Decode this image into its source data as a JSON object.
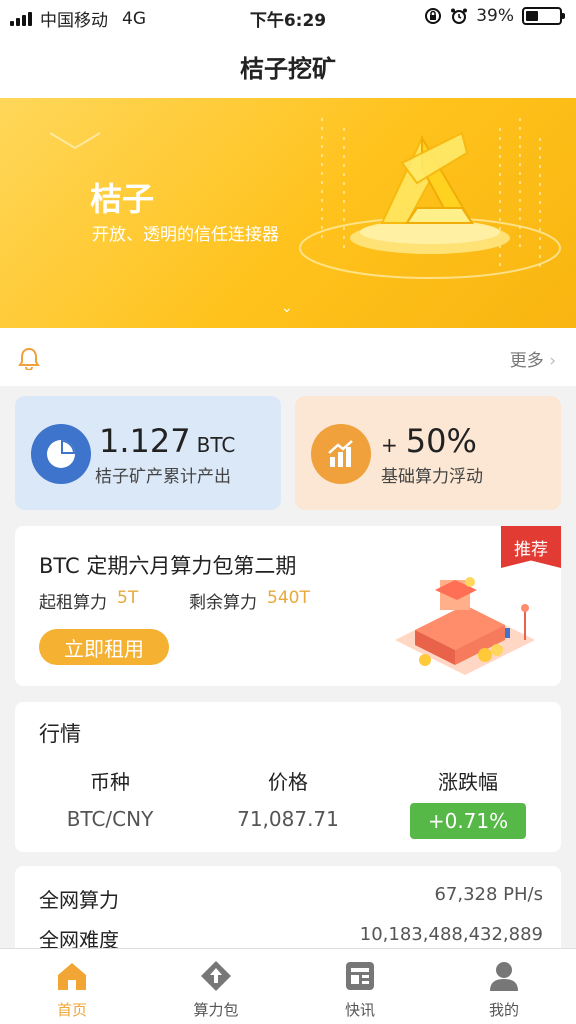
{
  "status_bar": {
    "carrier": "中国移动",
    "network": "4G",
    "time": "下午6:29",
    "battery": "39%",
    "battery_level": 0.39
  },
  "header": {
    "title": "桔子挖矿"
  },
  "banner": {
    "title": "桔子",
    "subtitle": "开放、透明的信任连接器"
  },
  "notice": {
    "more_label": "更多"
  },
  "stats": [
    {
      "value": "1.127",
      "unit": "BTC",
      "label": "桔子矿产累计产出",
      "icon": "pie-chart-icon"
    },
    {
      "prefix": "+",
      "value": "50%",
      "label": "基础算力浮动",
      "icon": "bar-chart-trend-icon"
    }
  ],
  "package": {
    "tag": "推荐",
    "title": "BTC 定期六月算力包第二期",
    "min_rent_label": "起租算力",
    "min_rent_value": "5T",
    "remaining_label": "剩余算力",
    "remaining_value": "540T",
    "button_label": "立即租用"
  },
  "market": {
    "title": "行情",
    "headers": [
      "币种",
      "价格",
      "涨跌幅"
    ],
    "row": {
      "pair": "BTC/CNY",
      "price": "71,087.71",
      "change": "+0.71%"
    },
    "change_color": "#56b947"
  },
  "network": {
    "hashrate_label": "全网算力",
    "hashrate_value": "67,328 PH/s",
    "difficulty_label": "全网难度",
    "difficulty_value": "10,183,488,432,889"
  },
  "tabs": [
    {
      "label": "首页",
      "icon": "home-icon",
      "active": true
    },
    {
      "label": "算力包",
      "icon": "upload-package-icon",
      "active": false
    },
    {
      "label": "快讯",
      "icon": "news-icon",
      "active": false
    },
    {
      "label": "我的",
      "icon": "user-icon",
      "active": false
    }
  ],
  "colors": {
    "accent": "#f5b131",
    "tag_red": "#e23b33",
    "blue": "#3e74cc",
    "orange": "#f0a13c"
  }
}
